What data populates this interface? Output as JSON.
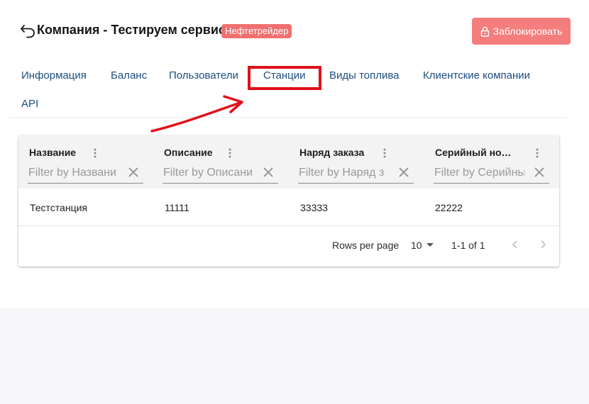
{
  "header": {
    "back_icon": "arrow-back-icon",
    "title": "Компания - Тестируем сервис",
    "badge": "Нефтетрейдер",
    "block_button": "Заблокировать",
    "block_icon": "lock-icon",
    "badge_color": "#f06f6f",
    "button_color": "#f47d7d"
  },
  "tabs": [
    {
      "label": "Информация"
    },
    {
      "label": "Баланс"
    },
    {
      "label": "Пользователи"
    },
    {
      "label": "Станции",
      "highlighted": true
    },
    {
      "label": "Виды топлива"
    },
    {
      "label": "Клиентские компании"
    },
    {
      "label": "API"
    }
  ],
  "annotation": {
    "color": "#e0101a",
    "shape": "arrow-pointing-to-tab"
  },
  "table": {
    "columns": [
      {
        "title": "Название",
        "filter_placeholder": "Filter by Названи"
      },
      {
        "title": "Описание",
        "filter_placeholder": "Filter by Описани"
      },
      {
        "title": "Наряд заказа",
        "filter_placeholder": "Filter by Наряд з"
      },
      {
        "title": "Серийный номер",
        "filter_placeholder": "Filter by Серийны"
      }
    ],
    "rows": [
      [
        "Тестстанция",
        "11111",
        "33333",
        "22222"
      ]
    ]
  },
  "pagination": {
    "rows_per_page_label": "Rows per page",
    "rows_per_page": "10",
    "range": "1-1 of 1"
  }
}
